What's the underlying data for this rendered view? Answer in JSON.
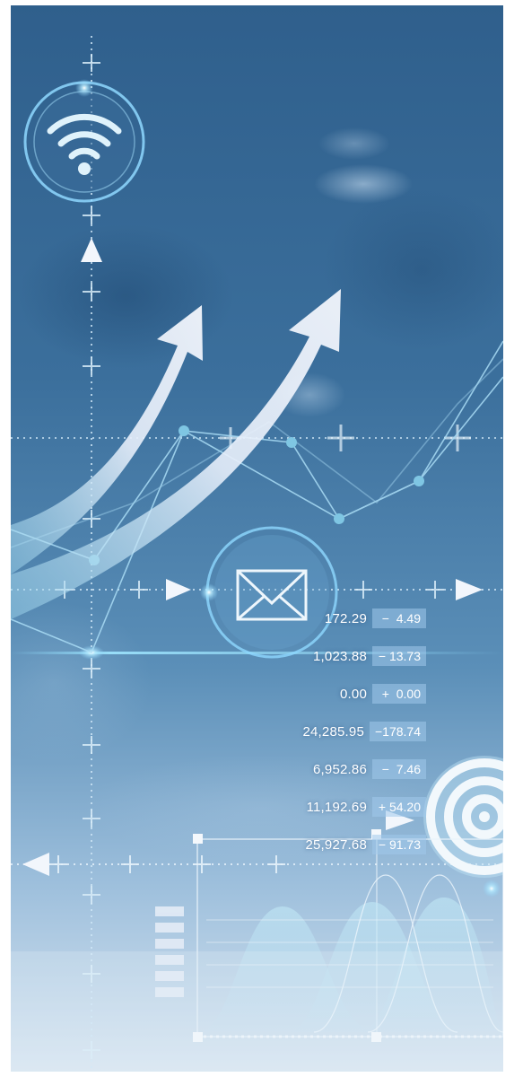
{
  "ticker": [
    {
      "value": "172.29",
      "change": "−  4.49"
    },
    {
      "value": "1,023.88",
      "change": "− 13.73"
    },
    {
      "value": "0.00",
      "change": "+  0.00"
    },
    {
      "value": "24,285.95",
      "change": "−178.74"
    },
    {
      "value": "6,952.86",
      "change": "−  7.46"
    },
    {
      "value": "11,192.69",
      "change": "+ 54.20"
    },
    {
      "value": "25,927.68",
      "change": "− 91.73"
    }
  ],
  "icons": {
    "wifi": "wifi-icon",
    "mail": "mail-icon",
    "target": "target-icon"
  },
  "colors": {
    "background_top": "#3a6a94",
    "background_bottom": "#cfe0ef",
    "accent_glow": "#8fd8ff",
    "arrow_white": "#eef3fb"
  }
}
